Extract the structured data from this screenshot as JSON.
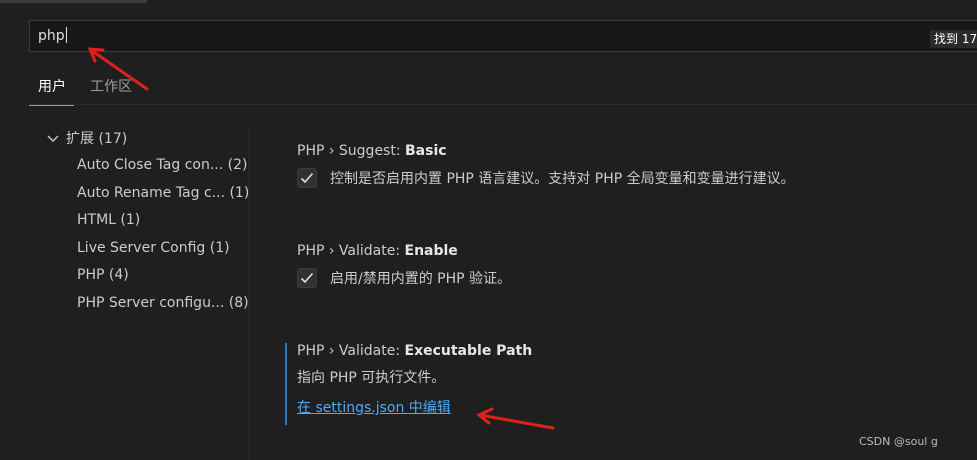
{
  "search": {
    "value": "php",
    "result_count": "找到 17"
  },
  "tabs": [
    {
      "label": "用户",
      "active": true
    },
    {
      "label": "工作区",
      "active": false
    }
  ],
  "tree": {
    "group_label": "扩展 (17)",
    "items": [
      {
        "label": "Auto Close Tag con... (2)"
      },
      {
        "label": "Auto Rename Tag c... (1)"
      },
      {
        "label": "HTML (1)"
      },
      {
        "label": "Live Server Config (1)"
      },
      {
        "label": "PHP (4)"
      },
      {
        "label": "PHP Server configu... (8)"
      }
    ]
  },
  "settings": [
    {
      "category": "PHP › Suggest: ",
      "name": "Basic",
      "checked": true,
      "description": "控制是否启用内置 PHP 语言建议。支持对 PHP 全局变量和变量进行建议。"
    },
    {
      "category": "PHP › Validate: ",
      "name": "Enable",
      "checked": true,
      "description": "启用/禁用内置的 PHP 验证。"
    },
    {
      "category": "PHP › Validate: ",
      "name": "Executable Path",
      "description": "指向 PHP 可执行文件。",
      "link": "在 settings.json 中编辑"
    }
  ],
  "watermark": "CSDN @soul g",
  "colors": {
    "background": "#1f1f1f",
    "accent": "#4daafc",
    "annotation_arrow": "#e0201a"
  }
}
